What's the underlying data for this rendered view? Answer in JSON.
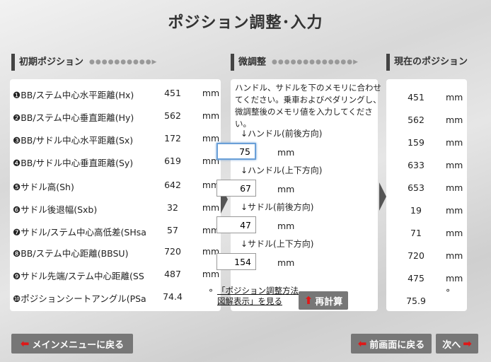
{
  "page": {
    "title": "ポジション調整･入力"
  },
  "sections": {
    "initial": "初期ポジション",
    "adjust": "微調整",
    "current": "現在のポジション"
  },
  "initial_rows": [
    {
      "label": "❶BB/ステム中心水平距離(Hx)",
      "value": "451",
      "unit": "mm"
    },
    {
      "label": "❷BB/ステム中心垂直距離(Hy)",
      "value": "562",
      "unit": "mm"
    },
    {
      "label": "❸BB/サドル中心水平距離(Sx)",
      "value": "172",
      "unit": "mm"
    },
    {
      "label": "❹BB/サドル中心垂直距離(Sy)",
      "value": "619",
      "unit": "mm"
    },
    {
      "label": "❺サドル高(Sh)",
      "value": "642",
      "unit": "mm"
    },
    {
      "label": "❻サドル後退幅(Sxb)",
      "value": "32",
      "unit": "mm"
    },
    {
      "label": "❼サドル/ステム中心高低差(SHsa",
      "value": "57",
      "unit": "mm"
    },
    {
      "label": "❽BB/ステム中心距離(BBSU)",
      "value": "720",
      "unit": "mm"
    },
    {
      "label": "❾サドル先端/ステム中心距離(SS",
      "value": "487",
      "unit": "mm"
    },
    {
      "label": "❿ポジションシートアングル(PSa",
      "value": "74.4",
      "unit": "°"
    }
  ],
  "adjust": {
    "note": "ハンドル、サドルを下のメモリに合わせてください。乗車およびペダリングし、微調整後のメモリ値を入力してください。",
    "fields": [
      {
        "label": "↓ハンドル(前後方向)",
        "value": "75",
        "unit": "mm"
      },
      {
        "label": "↓ハンドル(上下方向)",
        "value": "67",
        "unit": "mm"
      },
      {
        "label": "↓サドル(前後方向)",
        "value": "47",
        "unit": "mm"
      },
      {
        "label": "↓サドル(上下方向)",
        "value": "154",
        "unit": "mm"
      }
    ],
    "link_line1": "「ポジション調整方法",
    "link_line2": "図解表示」を見る",
    "recalc_button": "再計算"
  },
  "current_rows": [
    {
      "value": "451",
      "unit": "mm"
    },
    {
      "value": "562",
      "unit": "mm"
    },
    {
      "value": "159",
      "unit": "mm"
    },
    {
      "value": "633",
      "unit": "mm"
    },
    {
      "value": "653",
      "unit": "mm"
    },
    {
      "value": "19",
      "unit": "mm"
    },
    {
      "value": "71",
      "unit": "mm"
    },
    {
      "value": "720",
      "unit": "mm"
    },
    {
      "value": "475",
      "unit": "mm"
    },
    {
      "value": "75.9",
      "unit": "°"
    }
  ],
  "footer": {
    "main_menu": "メインメニューに戻る",
    "back": "前画面に戻る",
    "next": "次へ"
  },
  "icons": {
    "left": "left-arrow-icon",
    "right": "right-arrow-icon",
    "up": "up-arrow-icon"
  },
  "colors": {
    "accent": "#e01818",
    "button": "#777777"
  }
}
